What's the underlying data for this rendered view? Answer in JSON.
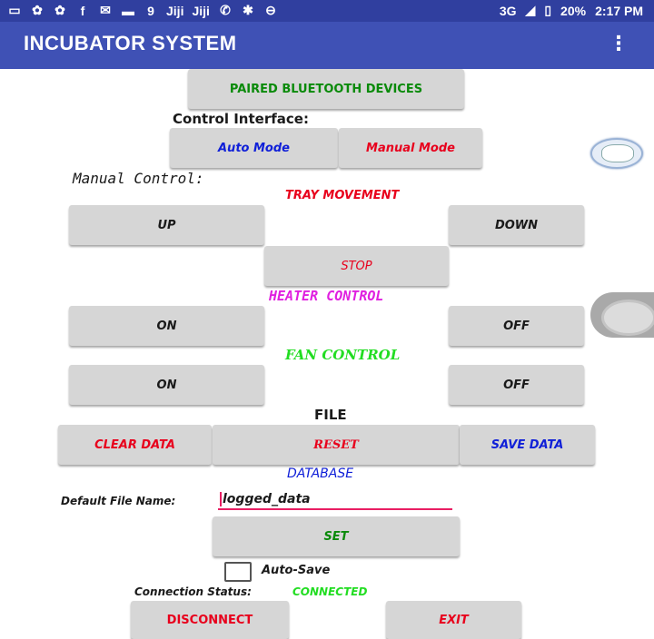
{
  "status_bar": {
    "left_icons": [
      "message-icon",
      "uc-browser-icon",
      "uc-browser-icon",
      "facebook-icon",
      "messenger-icon",
      "mail-icon",
      "notification-icon",
      "jiji-icon",
      "jiji-icon",
      "whatsapp-icon",
      "bluetooth-icon",
      "do-not-disturb-icon"
    ],
    "left_glyphs": [
      "▭",
      "✿",
      "✿",
      "f",
      "✉",
      "▬",
      "9",
      "Jiji",
      "Jiji",
      "✆",
      "✱",
      "⊖"
    ],
    "network": "3G",
    "battery": "20%",
    "time": "2:17 PM"
  },
  "app_bar": {
    "title": "INCUBATOR SYSTEM",
    "menu_glyph": "⋮"
  },
  "buttons": {
    "paired": "PAIRED BLUETOOTH DEVICES",
    "auto_mode": "Auto Mode",
    "manual_mode": "Manual Mode",
    "up": "UP",
    "down": "DOWN",
    "stop": "STOP",
    "heater_on": "ON",
    "heater_off": "OFF",
    "fan_on": "ON",
    "fan_off": "OFF",
    "clear_data": "CLEAR DATA",
    "reset": "RESET",
    "save_data": "SAVE DATA",
    "set": "SET",
    "disconnect": "DISCONNECT",
    "exit": "EXIT"
  },
  "labels": {
    "control_interface": "Control Interface:",
    "manual_control": "Manual  Control:",
    "tray_movement": "TRAY MOVEMENT",
    "heater_control": "HEATER  CONTROL",
    "fan_control": "FAN CONTROL",
    "file": "FILE",
    "database": "DATABASE",
    "default_file_name": "Default File Name:",
    "auto_save": "Auto-Save",
    "connection_status": "Connection Status:",
    "connection_value": "CONNECTED"
  },
  "file_name_input": {
    "value": "logged_data"
  },
  "auto_save_checked": false,
  "colors": {
    "app_bar": "#3f51b5",
    "status_bar": "#303f9f",
    "red": "#e8001c",
    "green": "#0a8a0a",
    "blue": "#1020d8",
    "magenta": "#e020e0",
    "bright_green": "#22dd22"
  }
}
